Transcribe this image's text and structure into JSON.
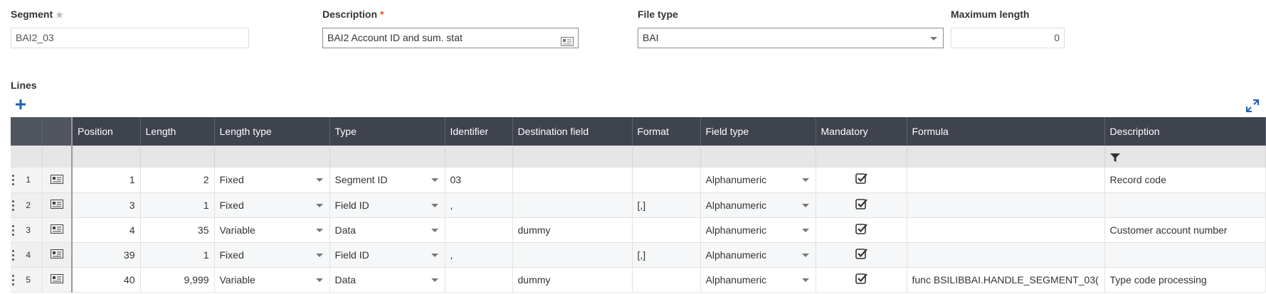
{
  "header": {
    "segment": {
      "label": "Segment",
      "value": "BAI2_03"
    },
    "description": {
      "label": "Description",
      "value": "BAI2 Account ID and sum. stat"
    },
    "file_type": {
      "label": "File type",
      "value": "BAI"
    },
    "max_length": {
      "label": "Maximum length",
      "value": "0"
    }
  },
  "lines": {
    "title": "Lines",
    "columns": [
      "Position",
      "Length",
      "Length type",
      "Type",
      "Identifier",
      "Destination field",
      "Format",
      "Field type",
      "Mandatory",
      "Formula",
      "Description"
    ],
    "rows": [
      {
        "num": "1",
        "position": "1",
        "length": "2",
        "length_type": "Fixed",
        "type": "Segment ID",
        "identifier": "03",
        "destination": "",
        "format": "",
        "field_type": "Alphanumeric",
        "mandatory": true,
        "formula": "",
        "description": "Record code"
      },
      {
        "num": "2",
        "position": "3",
        "length": "1",
        "length_type": "Fixed",
        "type": "Field ID",
        "identifier": ",",
        "destination": "",
        "format": "[,]",
        "field_type": "Alphanumeric",
        "mandatory": true,
        "formula": "",
        "description": ""
      },
      {
        "num": "3",
        "position": "4",
        "length": "35",
        "length_type": "Variable",
        "type": "Data",
        "identifier": "",
        "destination": "dummy",
        "format": "",
        "field_type": "Alphanumeric",
        "mandatory": true,
        "formula": "",
        "description": "Customer account number"
      },
      {
        "num": "4",
        "position": "39",
        "length": "1",
        "length_type": "Fixed",
        "type": "Field ID",
        "identifier": ",",
        "destination": "",
        "format": "[,]",
        "field_type": "Alphanumeric",
        "mandatory": true,
        "formula": "",
        "description": ""
      },
      {
        "num": "5",
        "position": "40",
        "length": "9,999",
        "length_type": "Variable",
        "type": "Data",
        "identifier": "",
        "destination": "dummy",
        "format": "",
        "field_type": "Alphanumeric",
        "mandatory": true,
        "formula": "func BSILIBBAI.HANDLE_SEGMENT_03(",
        "description": "Type code processing"
      }
    ]
  },
  "icons": {
    "segment_optional": "star-icon",
    "description_lookup": "detail-card-icon",
    "file_type_dropdown": "chevron-down-icon",
    "add": "plus-icon",
    "expand": "expand-icon",
    "filter": "filter-icon",
    "row_detail": "detail-card-icon",
    "row_handle": "drag-handle-icon",
    "mandatory": "checkbox-checked-icon"
  },
  "colors": {
    "header_bg": "#3e434d",
    "required": "#e2541e",
    "accent": "#1f5fb5"
  }
}
